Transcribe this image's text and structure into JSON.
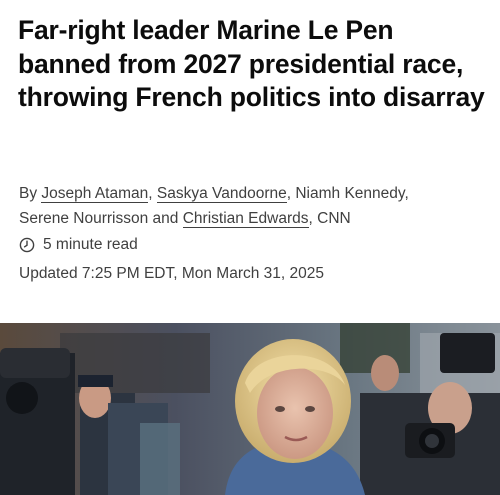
{
  "article": {
    "headline": "Far-right leader Marine Le Pen banned from 2027 presidential race, throwing French politics into disarray",
    "byline": {
      "prefix": "By ",
      "authors": [
        {
          "name": "Joseph Ataman",
          "linked": true,
          "sep": ", "
        },
        {
          "name": "Saskya Vandoorne",
          "linked": true,
          "sep": ", "
        },
        {
          "name": "Niamh Kennedy",
          "linked": false,
          "sep": ", "
        },
        {
          "name": "Serene Nourrisson",
          "linked": false,
          "sep": " and "
        },
        {
          "name": "Christian Edwards",
          "linked": true,
          "sep": ", "
        }
      ],
      "outlet": "CNN"
    },
    "read_time": "5 minute read",
    "read_time_icon": "clock-icon",
    "updated": "Updated 7:25 PM EDT, Mon March 31, 2025"
  },
  "colors": {
    "headline": "#0c0c0c",
    "meta_text": "#404040",
    "background": "#ffffff"
  },
  "media": {
    "type": "photo",
    "subject": "Marine Le Pen surrounded by press photographers"
  }
}
